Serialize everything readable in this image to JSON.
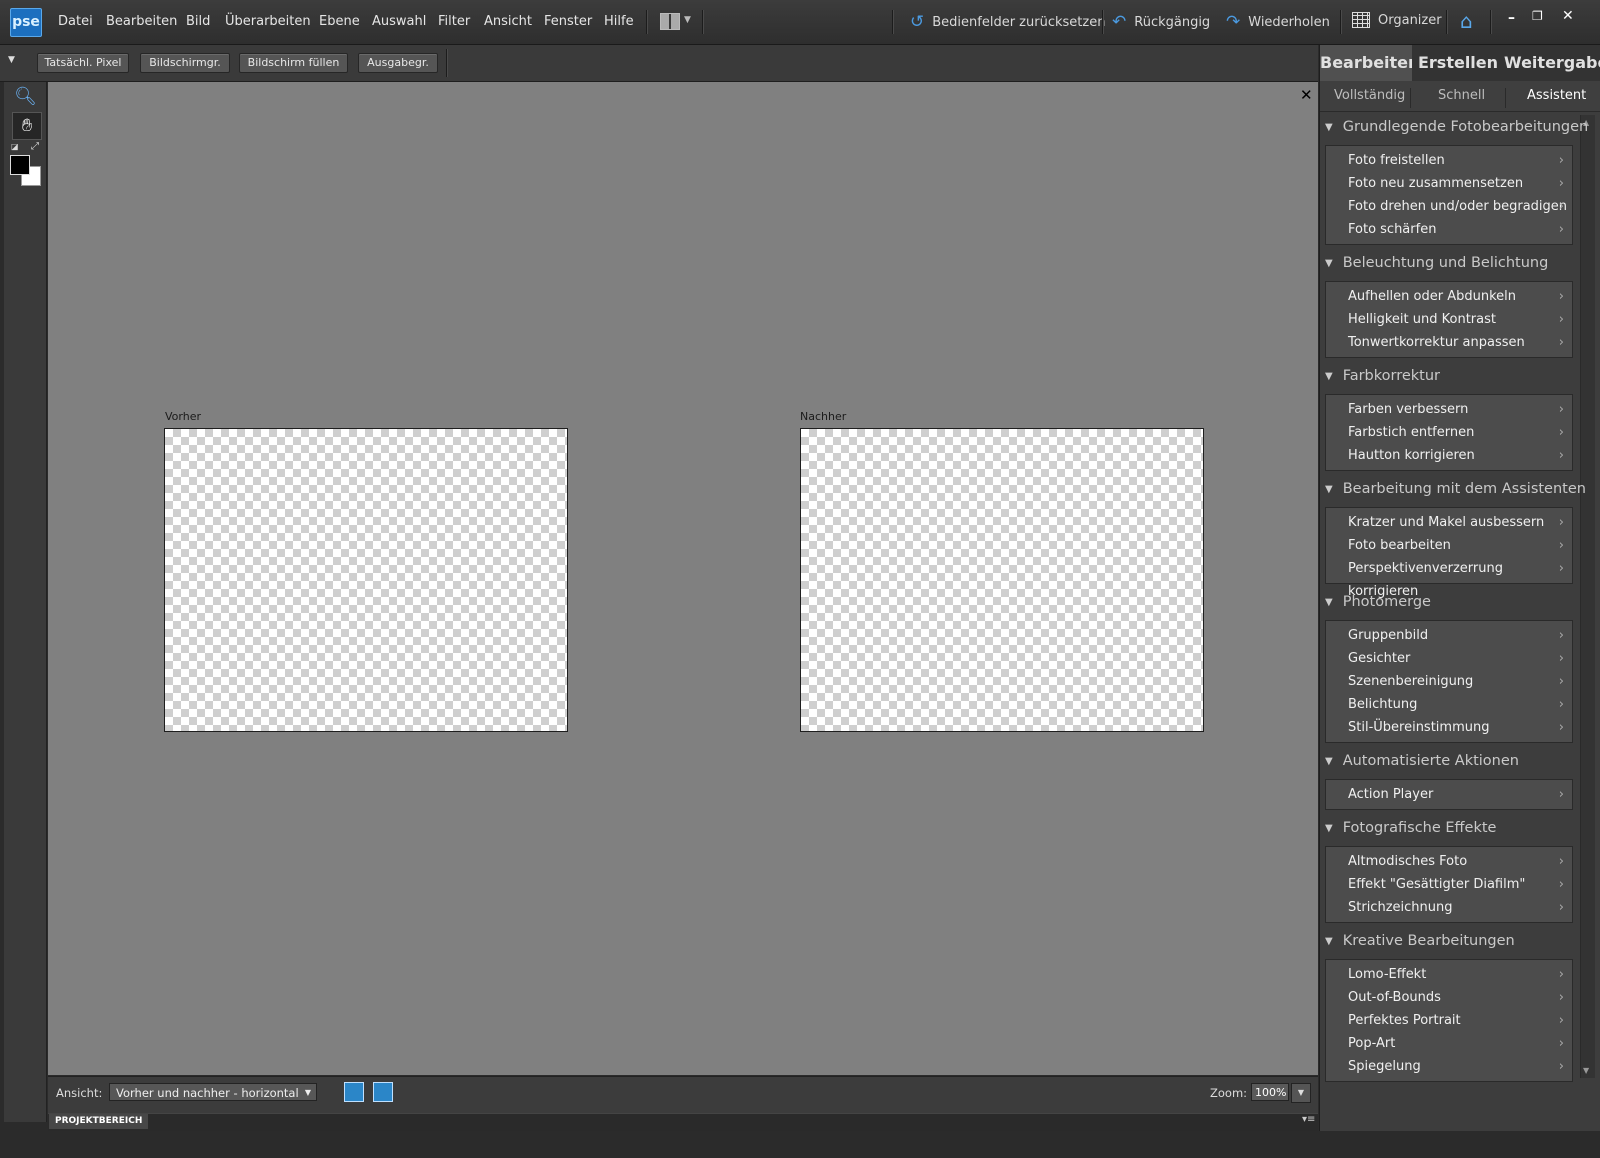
{
  "app": {
    "logo": "pse"
  },
  "menubar": {
    "items": [
      "Datei",
      "Bearbeiten",
      "Bild",
      "Überarbeiten",
      "Ebene",
      "Auswahl",
      "Filter",
      "Ansicht",
      "Fenster",
      "Hilfe"
    ],
    "reset_panels": "Bedienfelder zurücksetzen",
    "undo": "Rückgängig",
    "redo": "Wiederholen",
    "organizer": "Organizer"
  },
  "optbar": {
    "buttons": [
      "Tatsächl. Pixel",
      "Bildschirmgr.",
      "Bildschirm füllen",
      "Ausgabegr."
    ]
  },
  "canvas": {
    "before_label": "Vorher",
    "after_label": "Nachher"
  },
  "viewbar": {
    "view_label": "Ansicht:",
    "view_value": "Vorher und nachher - horizontal",
    "zoom_label": "Zoom:",
    "zoom_value": "100%"
  },
  "project": {
    "label": "PROJEKTBEREICH"
  },
  "panel": {
    "tabs": [
      "Bearbeiten",
      "Erstellen",
      "Weitergabe"
    ],
    "subtabs": [
      "Vollständig",
      "Schnell",
      "Assistent"
    ],
    "sections": [
      {
        "title": "Grundlegende Fotobearbeitungen",
        "items": [
          "Foto freistellen",
          "Foto neu zusammensetzen",
          "Foto drehen und/oder begradigen",
          "Foto schärfen"
        ]
      },
      {
        "title": "Beleuchtung und Belichtung",
        "items": [
          "Aufhellen oder Abdunkeln",
          "Helligkeit und Kontrast",
          "Tonwertkorrektur anpassen"
        ]
      },
      {
        "title": "Farbkorrektur",
        "items": [
          "Farben verbessern",
          "Farbstich entfernen",
          "Hautton korrigieren"
        ]
      },
      {
        "title": "Bearbeitung mit dem Assistenten",
        "items": [
          "Kratzer und Makel ausbessern",
          "Foto bearbeiten",
          "Perspektivenverzerrung korrigieren"
        ]
      },
      {
        "title": "Photomerge",
        "items": [
          "Gruppenbild",
          "Gesichter",
          "Szenenbereinigung",
          "Belichtung",
          "Stil-Übereinstimmung"
        ]
      },
      {
        "title": "Automatisierte Aktionen",
        "items": [
          "Action Player"
        ]
      },
      {
        "title": "Fotografische Effekte",
        "items": [
          "Altmodisches Foto",
          "Effekt \"Gesättigter Diafilm\"",
          "Strichzeichnung"
        ]
      },
      {
        "title": "Kreative Bearbeitungen",
        "items": [
          "Lomo-Effekt",
          "Out-of-Bounds",
          "Perfektes Portrait",
          "Pop-Art",
          "Spiegelung"
        ]
      }
    ]
  }
}
